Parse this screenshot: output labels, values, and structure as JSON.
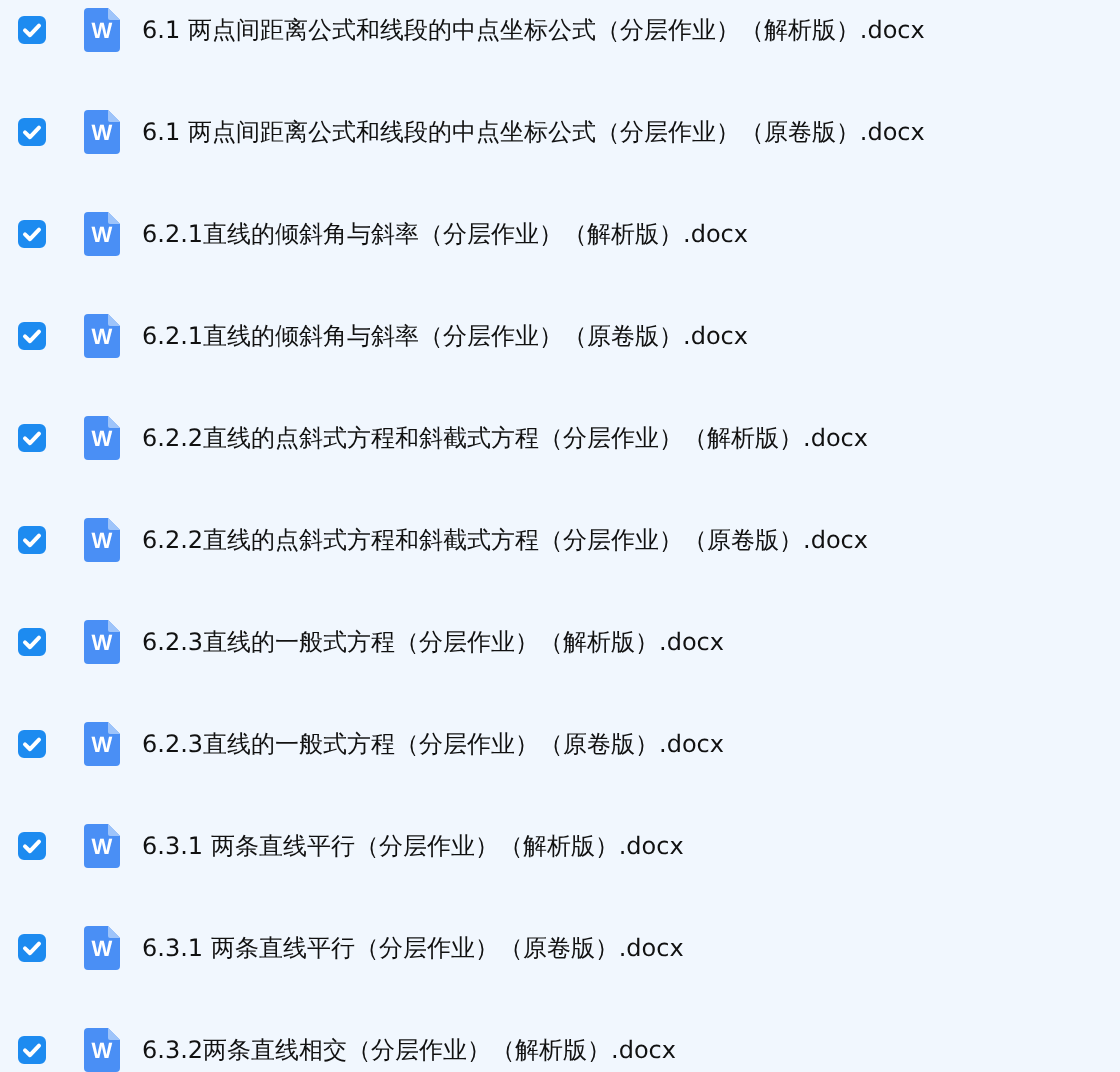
{
  "files": [
    {
      "name": "6.1 两点间距离公式和线段的中点坐标公式（分层作业）（解析版）.docx",
      "checked": true,
      "icon_letter": "W"
    },
    {
      "name": "6.1 两点间距离公式和线段的中点坐标公式（分层作业）（原卷版）.docx",
      "checked": true,
      "icon_letter": "W"
    },
    {
      "name": "6.2.1直线的倾斜角与斜率（分层作业）（解析版）.docx",
      "checked": true,
      "icon_letter": "W"
    },
    {
      "name": "6.2.1直线的倾斜角与斜率（分层作业）（原卷版）.docx",
      "checked": true,
      "icon_letter": "W"
    },
    {
      "name": "6.2.2直线的点斜式方程和斜截式方程（分层作业）（解析版）.docx",
      "checked": true,
      "icon_letter": "W"
    },
    {
      "name": "6.2.2直线的点斜式方程和斜截式方程（分层作业）（原卷版）.docx",
      "checked": true,
      "icon_letter": "W"
    },
    {
      "name": "6.2.3直线的一般式方程（分层作业）（解析版）.docx",
      "checked": true,
      "icon_letter": "W"
    },
    {
      "name": "6.2.3直线的一般式方程（分层作业）（原卷版）.docx",
      "checked": true,
      "icon_letter": "W"
    },
    {
      "name": "6.3.1 两条直线平行（分层作业）（解析版）.docx",
      "checked": true,
      "icon_letter": "W"
    },
    {
      "name": "6.3.1 两条直线平行（分层作业）（原卷版）.docx",
      "checked": true,
      "icon_letter": "W"
    },
    {
      "name": "6.3.2两条直线相交（分层作业）（解析版）.docx",
      "checked": true,
      "icon_letter": "W"
    }
  ]
}
